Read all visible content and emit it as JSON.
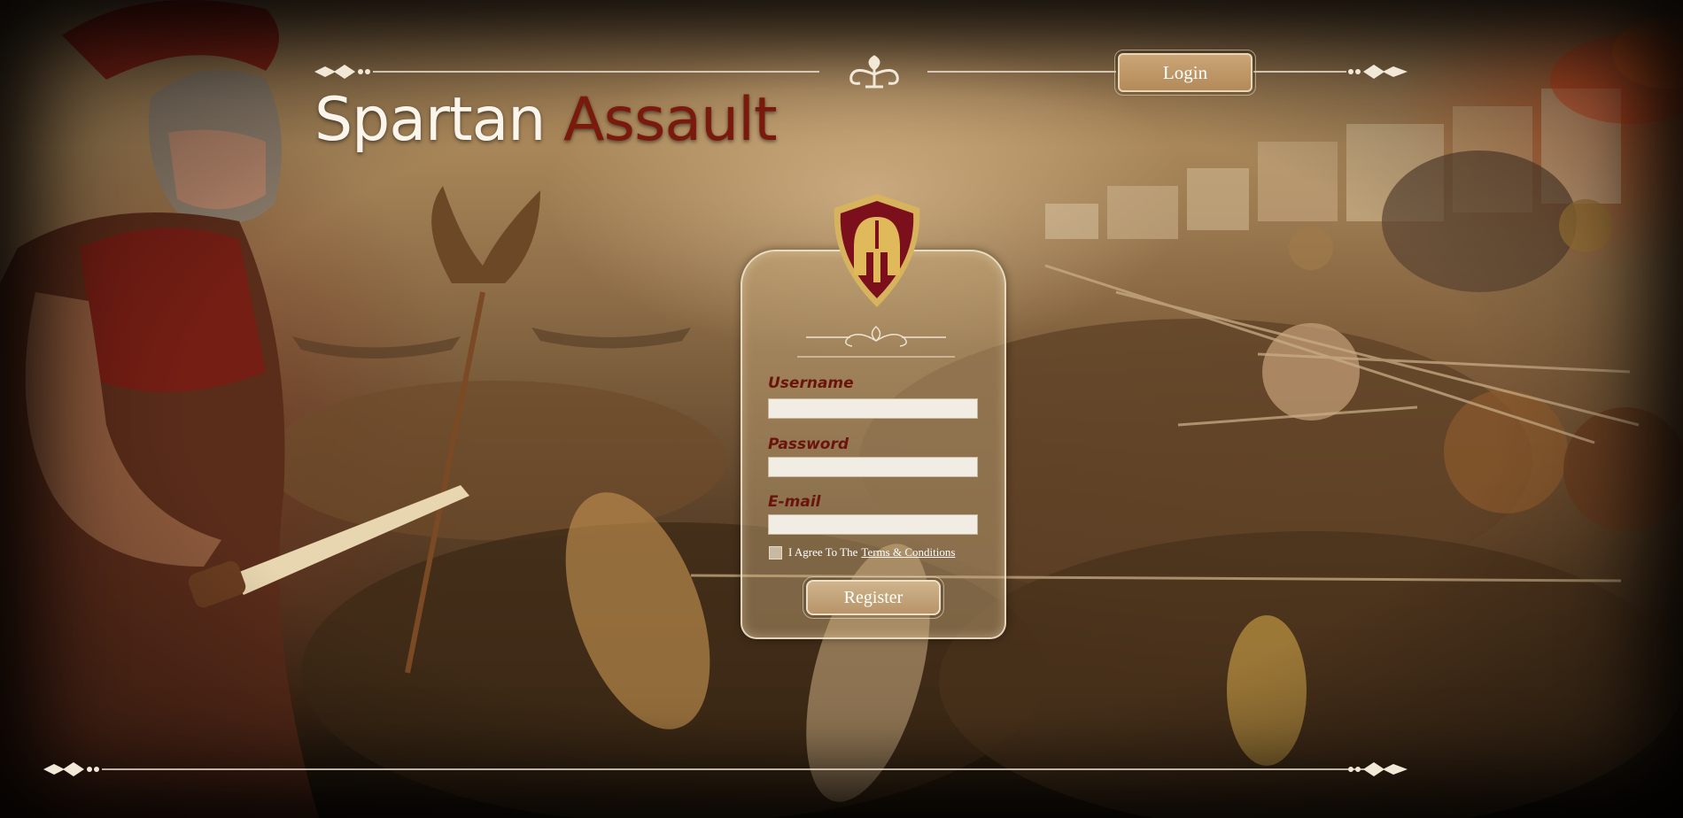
{
  "header": {
    "title_primary": "Spartan",
    "title_accent": "Assault",
    "login_label": "Login"
  },
  "form": {
    "username_label": "Username",
    "username_value": "",
    "password_label": "Password",
    "password_value": "",
    "email_label": "E-mail",
    "email_value": "",
    "agree_text": "I Agree To The",
    "terms_link": "Terms & Conditions",
    "register_label": "Register"
  },
  "colors": {
    "accent_red": "#7a1a0c",
    "label_red": "#6b140b",
    "button_gold": "#c6a77b"
  },
  "icons": {
    "emblem": "spartan-helmet-shield-icon",
    "top_center": "fleur-de-lis-icon",
    "ornaments": "diamond-ornament-icon"
  }
}
